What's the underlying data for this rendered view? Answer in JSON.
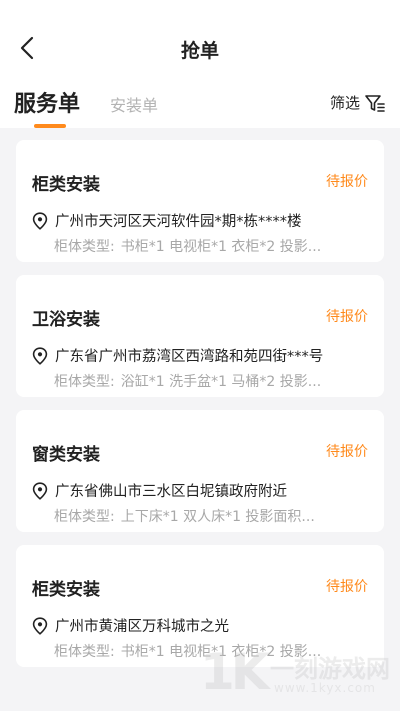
{
  "header": {
    "title": "抢单"
  },
  "tabs": {
    "active_label": "服务单",
    "inactive_label": "安装单"
  },
  "filter": {
    "label": "筛选"
  },
  "colors": {
    "accent": "#ff8a1c",
    "background": "#f4f4f6",
    "card": "#ffffff",
    "muted_text": "#a8a8a8"
  },
  "orders": [
    {
      "title": "柜类安装",
      "status": "待报价",
      "address": "广州市天河区天河软件园*期*栋****楼",
      "type_label": "柜体类型:",
      "type_value": "书柜*1 电视柜*1 衣柜*2 投影..."
    },
    {
      "title": "卫浴安装",
      "status": "待报价",
      "address": "广东省广州市荔湾区西湾路和苑四街***号",
      "type_label": "柜体类型:",
      "type_value": "浴缸*1 洗手盆*1 马桶*2 投影..."
    },
    {
      "title": "窗类安装",
      "status": "待报价",
      "address": "广东省佛山市三水区白坭镇政府附近",
      "type_label": "柜体类型:",
      "type_value": "上下床*1 双人床*1 投影面积..."
    },
    {
      "title": "柜类安装",
      "status": "待报价",
      "address": "广州市黄浦区万科城市之光",
      "type_label": "柜体类型:",
      "type_value": "书柜*1 电视柜*1 衣柜*2 投影..."
    }
  ],
  "watermark": {
    "logo": "1K",
    "text": "一刻游戏网",
    "url": "www.1kyx.com"
  }
}
